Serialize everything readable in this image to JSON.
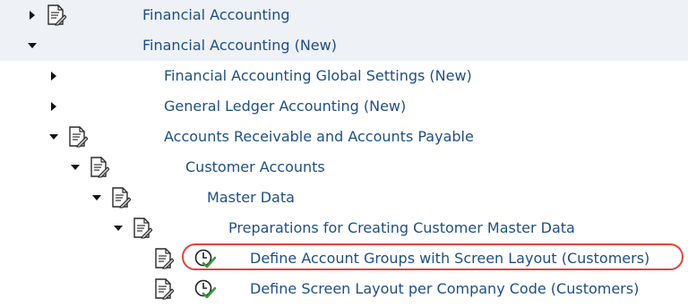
{
  "tree": {
    "items": [
      {
        "label": "Financial Accounting",
        "expanded": false,
        "has_doc_icon": true,
        "has_clock_icon": false
      },
      {
        "label": "Financial Accounting (New)",
        "expanded": true,
        "has_doc_icon": false,
        "has_clock_icon": false
      },
      {
        "label": "Financial Accounting Global Settings (New)",
        "expanded": false,
        "has_doc_icon": false,
        "has_clock_icon": false
      },
      {
        "label": "General Ledger Accounting (New)",
        "expanded": false,
        "has_doc_icon": false,
        "has_clock_icon": false
      },
      {
        "label": "Accounts Receivable and Accounts Payable",
        "expanded": true,
        "has_doc_icon": true,
        "has_clock_icon": false
      },
      {
        "label": "Customer Accounts",
        "expanded": true,
        "has_doc_icon": true,
        "has_clock_icon": false
      },
      {
        "label": "Master Data",
        "expanded": true,
        "has_doc_icon": true,
        "has_clock_icon": false
      },
      {
        "label": "Preparations for Creating Customer Master Data",
        "expanded": true,
        "has_doc_icon": true,
        "has_clock_icon": false
      },
      {
        "label": "Define Account Groups with Screen Layout (Customers)",
        "expanded": null,
        "has_doc_icon": true,
        "has_clock_icon": true,
        "highlighted": true
      },
      {
        "label": "Define Screen Layout per Company Code (Customers)",
        "expanded": null,
        "has_doc_icon": true,
        "has_clock_icon": true
      }
    ]
  },
  "colors": {
    "label_text": "#1e4f86",
    "row_band": "#eef1f6",
    "highlight_ring": "#e0443a",
    "arrow": "#111111",
    "clock_check": "#3a9a3a"
  },
  "icons": {
    "expanded_arrow": "triangle-down-icon",
    "collapsed_arrow": "triangle-right-icon",
    "document": "document-icon",
    "execute": "clock-check-icon"
  }
}
